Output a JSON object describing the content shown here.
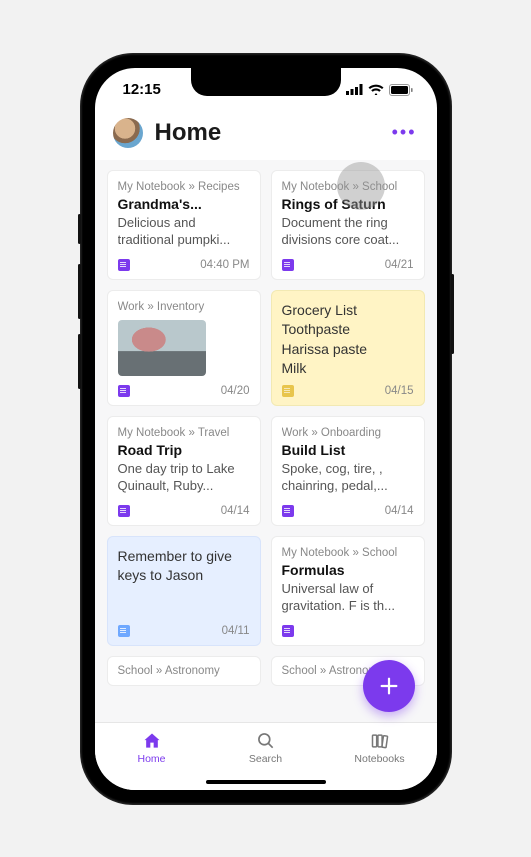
{
  "status": {
    "time": "12:15"
  },
  "header": {
    "title": "Home",
    "more_label": "•••"
  },
  "tabs": {
    "home": "Home",
    "search": "Search",
    "notebooks": "Notebooks"
  },
  "fab": {
    "label": "+"
  },
  "cards": [
    {
      "crumb": "My Notebook » Recipes",
      "title": "Grandma's...",
      "body": "Delicious and traditional pumpki...",
      "time": "04:40 PM",
      "style": "white"
    },
    {
      "crumb": "My Notebook » School",
      "title": "Rings of Saturn",
      "body": "Document the ring divisions core coat...",
      "time": "04/21",
      "style": "white"
    },
    {
      "crumb": "Work » Inventory",
      "title": "",
      "body": "",
      "time": "04/20",
      "style": "white",
      "thumb": true
    },
    {
      "crumb": "",
      "title": "",
      "body": "Grocery List\nToothpaste\nHarissa paste\nMilk",
      "time": "04/15",
      "style": "yellow"
    },
    {
      "crumb": "My Notebook » Travel",
      "title": "Road Trip",
      "body": "One day trip to Lake Quinault, Ruby...",
      "time": "04/14",
      "style": "white"
    },
    {
      "crumb": "Work » Onboarding",
      "title": "Build List",
      "body": "Spoke, cog, tire, , chainring, pedal,...",
      "time": "04/14",
      "style": "white"
    },
    {
      "crumb": "",
      "title": "",
      "body": "Remember to give keys to Jason",
      "time": "04/11",
      "style": "blue"
    },
    {
      "crumb": "My Notebook » School",
      "title": "Formulas",
      "body": "Universal law of gravitation. F is th...",
      "time": "",
      "style": "white"
    },
    {
      "crumb": "School » Astronomy",
      "title": "",
      "body": "",
      "time": "",
      "style": "white",
      "partial": true
    },
    {
      "crumb": "School » Astronomy",
      "title": "",
      "body": "",
      "time": "",
      "style": "white",
      "partial": true
    }
  ]
}
